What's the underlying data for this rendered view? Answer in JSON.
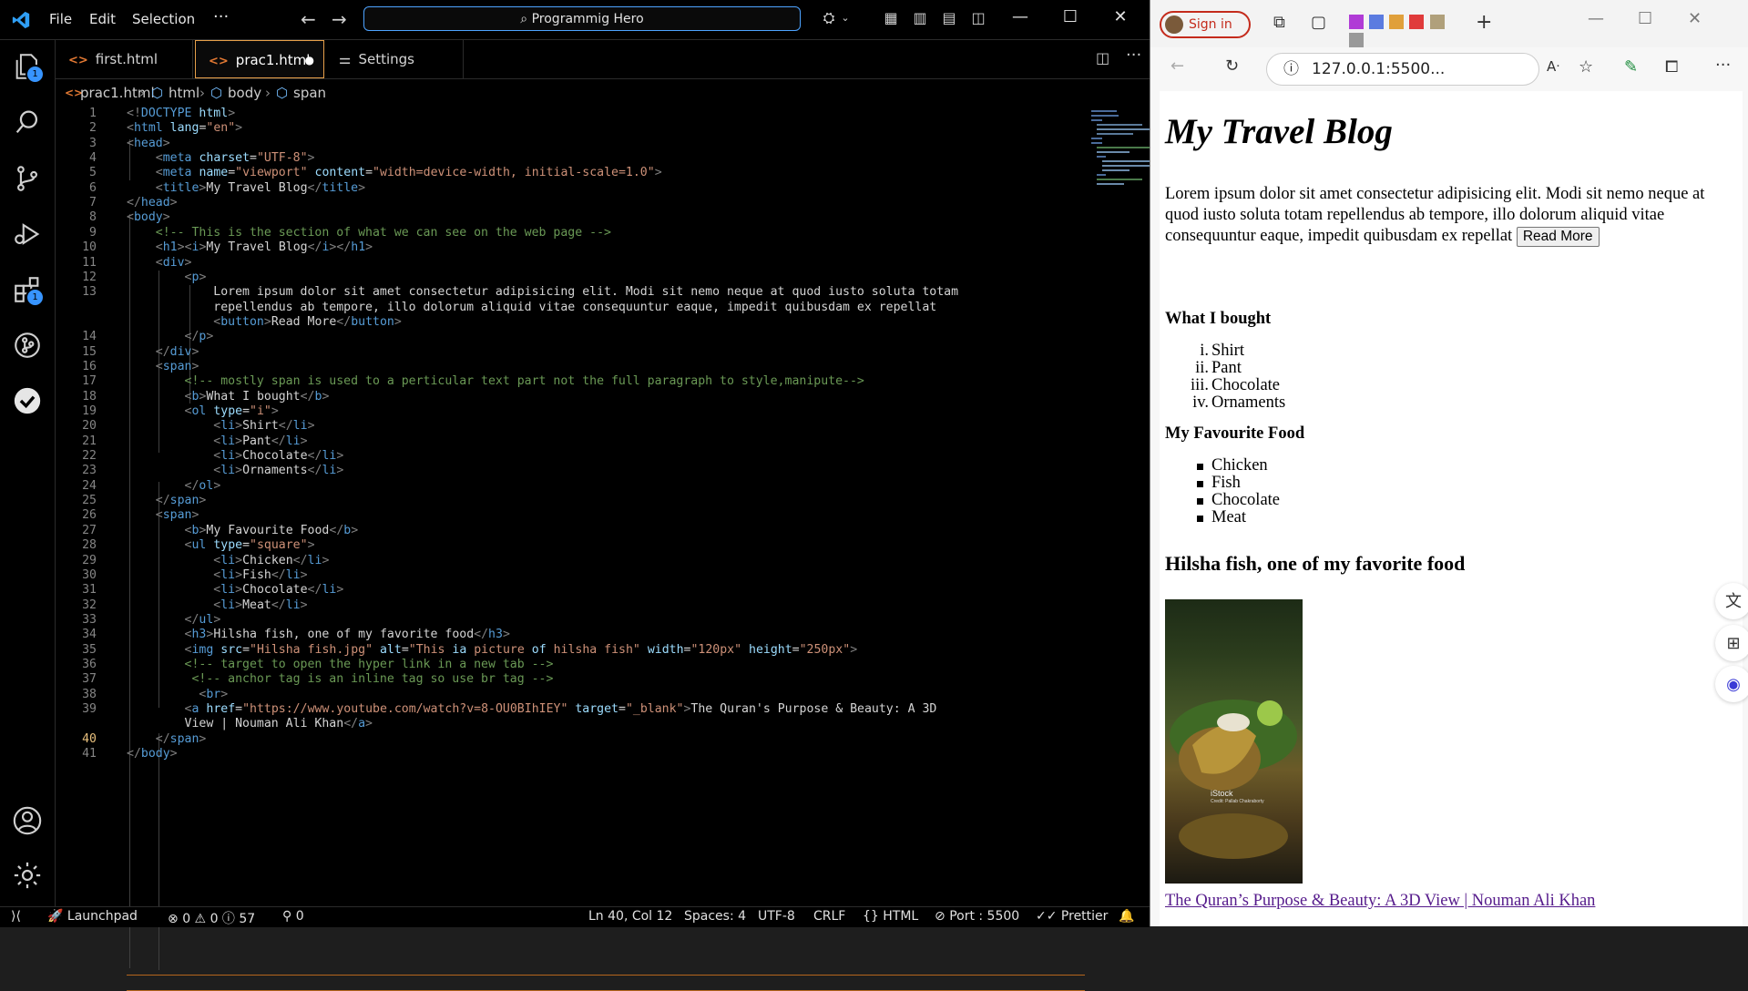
{
  "vscode": {
    "menu": [
      "File",
      "Edit",
      "Selection",
      "···"
    ],
    "search_text": "Programmig Hero",
    "tabs": [
      {
        "label": "first.html"
      },
      {
        "label": "prac1.html"
      },
      {
        "label": "Settings"
      }
    ],
    "breadcrumb": [
      "prac1.html",
      "html",
      "body",
      "span"
    ],
    "badges": {
      "explorer": "1",
      "extensions": "1"
    },
    "line_numbers": [
      "1",
      "2",
      "3",
      "4",
      "5",
      "6",
      "7",
      "8",
      "9",
      "10",
      "11",
      "12",
      "13",
      "",
      "",
      "14",
      "15",
      "16",
      "17",
      "18",
      "19",
      "20",
      "21",
      "22",
      "23",
      "24",
      "25",
      "26",
      "27",
      "28",
      "29",
      "30",
      "31",
      "32",
      "33",
      "34",
      "35",
      "36",
      "37",
      "38",
      "39",
      "",
      "40",
      "41"
    ],
    "code": [
      "<!DOCTYPE html>",
      "<html lang=\"en\">",
      "<head>",
      "    <meta charset=\"UTF-8\">",
      "    <meta name=\"viewport\" content=\"width=device-width, initial-scale=1.0\">",
      "    <title>My Travel Blog</title>",
      "</head>",
      "<body>",
      "    <!-- This is the section of what we can see on the web page -->",
      "    <h1><i>My Travel Blog</i></h1>",
      "    <div>",
      "        <p>",
      "            Lorem ipsum dolor sit amet consectetur adipisicing elit. Modi sit nemo neque at quod iusto soluta totam",
      "            repellendus ab tempore, illo dolorum aliquid vitae consequuntur eaque, impedit quibusdam ex repellat",
      "            <button>Read More</button>",
      "        </p>",
      "    </div>",
      "    <span>",
      "        <!-- mostly span is used to a perticular text part not the full paragraph to style,manipute-->",
      "        <b>What I bought</b>",
      "        <ol type=\"i\">",
      "            <li>Shirt</li>",
      "            <li>Pant</li>",
      "            <li>Chocolate</li>",
      "            <li>Ornaments</li>",
      "        </ol>",
      "    </span>",
      "    <span>",
      "        <b>My Favourite Food</b>",
      "        <ul type=\"square\">",
      "            <li>Chicken</li>",
      "            <li>Fish</li>",
      "            <li>Chocolate</li>",
      "            <li>Meat</li>",
      "        </ul>",
      "        <h3>Hilsha fish, one of my favorite food</h3>",
      "        <img src=\"Hilsha fish.jpg\" alt=\"This ia picture of hilsha fish\" width=\"120px\" height=\"250px\">",
      "        <!-- target to open the hyper link in a new tab -->",
      "         <!-- anchor tag is an inline tag so use br tag -->",
      "          <br>",
      "        <a href=\"https://www.youtube.com/watch?v=8-OU0BIhIEY\" target=\"_blank\">The Quran's Purpose & Beauty: A 3D",
      "        View | Nouman Ali Khan</a>",
      "    </span>",
      "</body>"
    ],
    "status": {
      "launchpad": "Launchpad",
      "errors": "0",
      "warnings": "0",
      "info": "57",
      "ports": "0",
      "position": "Ln 40, Col 12",
      "spaces": "Spaces: 4",
      "encoding": "UTF-8",
      "eol": "CRLF",
      "language": "HTML",
      "port": "Port : 5500",
      "formatter": "Prettier"
    }
  },
  "browser": {
    "signin_label": "Sign in",
    "address": "127.0.0.1:5500...",
    "page": {
      "h1": "My Travel Blog",
      "paragraph": "Lorem ipsum dolor sit amet consectetur adipisicing elit. Modi sit nemo neque at quod iusto soluta totam repellendus ab tempore, illo dolorum aliquid vitae consequuntur eaque, impedit quibusdam ex repellat",
      "button": "Read More",
      "bought_heading": "What I bought",
      "bought_markers": [
        "i.",
        "ii.",
        "iii.",
        "iv."
      ],
      "bought_items": [
        "Shirt",
        "Pant",
        "Chocolate",
        "Ornaments"
      ],
      "food_heading": "My Favourite Food",
      "food_items": [
        "Chicken",
        "Fish",
        "Chocolate",
        "Meat"
      ],
      "h3": "Hilsha fish, one of my favorite food",
      "image_watermark": "iStock",
      "image_credit": "Credit: Pallab Chakraborty",
      "link": "The Quran’s Purpose & Beauty: A 3D View | Nouman Ali Khan"
    }
  }
}
